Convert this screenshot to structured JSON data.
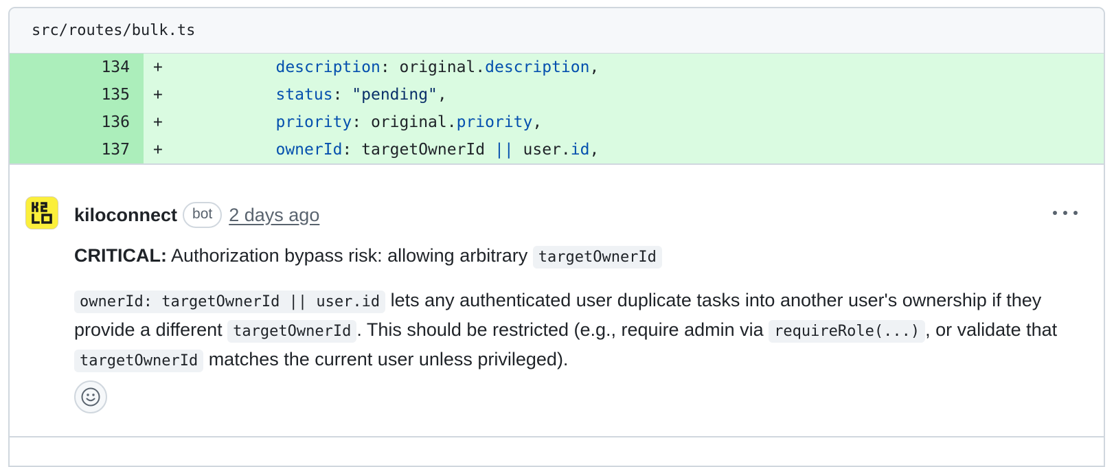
{
  "file": {
    "path": "src/routes/bulk.ts"
  },
  "diff": {
    "lines": [
      {
        "number": "134",
        "marker": "+",
        "indent": "          ",
        "tokens": [
          {
            "t": "prop",
            "v": "description"
          },
          {
            "t": "plain",
            "v": ": original."
          },
          {
            "t": "prop",
            "v": "description"
          },
          {
            "t": "plain",
            "v": ","
          }
        ]
      },
      {
        "number": "135",
        "marker": "+",
        "indent": "          ",
        "tokens": [
          {
            "t": "prop",
            "v": "status"
          },
          {
            "t": "plain",
            "v": ": "
          },
          {
            "t": "str",
            "v": "\"pending\""
          },
          {
            "t": "plain",
            "v": ","
          }
        ]
      },
      {
        "number": "136",
        "marker": "+",
        "indent": "          ",
        "tokens": [
          {
            "t": "prop",
            "v": "priority"
          },
          {
            "t": "plain",
            "v": ": original."
          },
          {
            "t": "prop",
            "v": "priority"
          },
          {
            "t": "plain",
            "v": ","
          }
        ]
      },
      {
        "number": "137",
        "marker": "+",
        "indent": "          ",
        "tokens": [
          {
            "t": "prop",
            "v": "ownerId"
          },
          {
            "t": "plain",
            "v": ": targetOwnerId "
          },
          {
            "t": "op",
            "v": "||"
          },
          {
            "t": "plain",
            "v": " user."
          },
          {
            "t": "prop",
            "v": "id"
          },
          {
            "t": "plain",
            "v": ","
          }
        ]
      }
    ]
  },
  "comment": {
    "author": "kiloconnect",
    "badge": "bot",
    "timestamp": "2 days ago",
    "avatar_icon": "kilo-logo-icon",
    "more_icon": "kebab-horizontal-icon",
    "reaction_icon": "smiley-icon",
    "heading_strong": "CRITICAL:",
    "heading_text": " Authorization bypass risk: allowing arbitrary ",
    "heading_code": "targetOwnerId",
    "p_code1": "ownerId: targetOwnerId || user.id",
    "p_text1": " lets any authenticated user duplicate tasks into another user's ownership if they provide a different ",
    "p_code2": "targetOwnerId",
    "p_text2": ". This should be restricted (e.g., require admin via ",
    "p_code3": "requireRole(...)",
    "p_text3": ", or validate that ",
    "p_code4": "targetOwnerId",
    "p_text4": " matches the current user unless privileged)."
  },
  "colors": {
    "added_bg": "#dafbe1",
    "added_gutter": "#aceebb",
    "avatar_bg": "#fbef3b",
    "syntax_prop": "#0550ae",
    "syntax_string": "#0a3069"
  }
}
